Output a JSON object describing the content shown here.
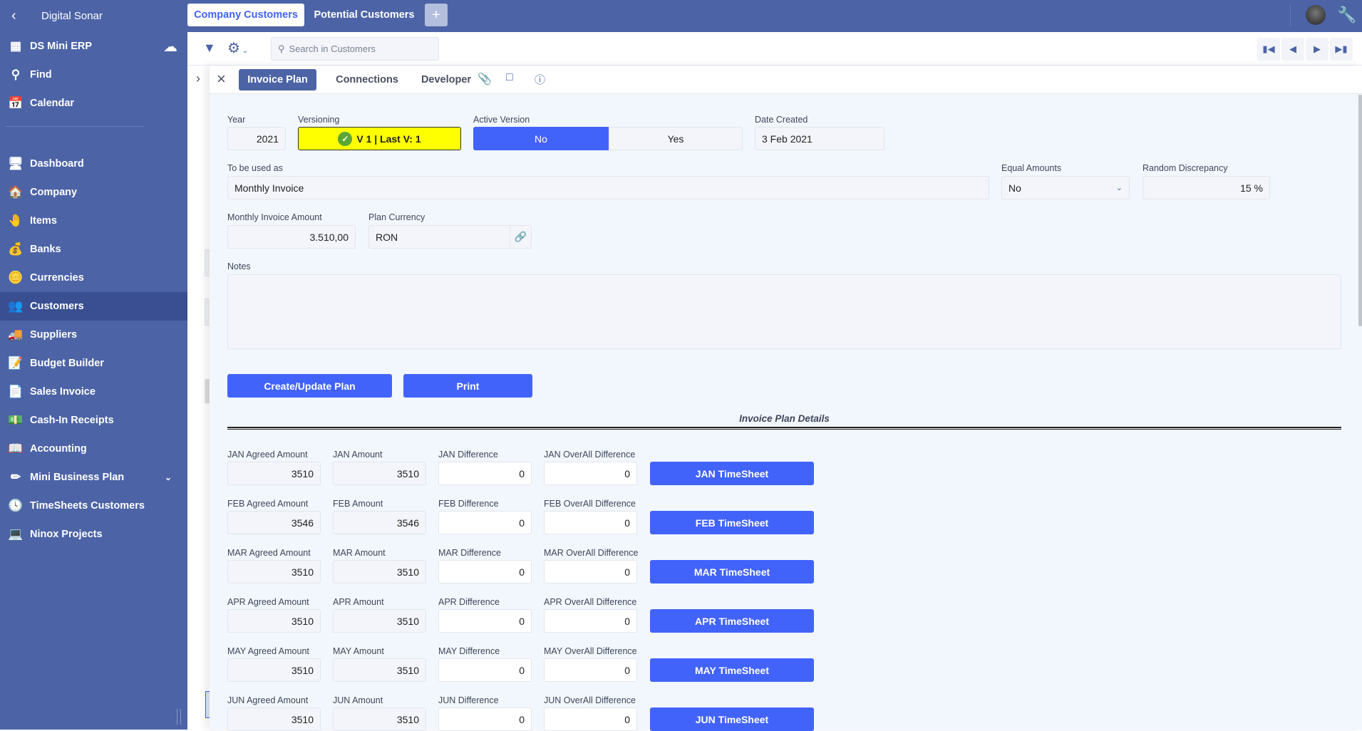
{
  "app": {
    "workspace": "Digital Sonar",
    "database": "DS Mini ERP"
  },
  "sidebar": {
    "items": [
      {
        "label": "Find",
        "icon": "search-icon"
      },
      {
        "label": "Calendar",
        "icon": "calendar-icon"
      },
      {
        "label": "Dashboard",
        "icon": "monitor-icon"
      },
      {
        "label": "Company",
        "icon": "house-icon"
      },
      {
        "label": "Items",
        "icon": "hand-coin-icon"
      },
      {
        "label": "Banks",
        "icon": "money-bag-icon"
      },
      {
        "label": "Currencies",
        "icon": "coins-icon"
      },
      {
        "label": "Customers",
        "icon": "people-icon",
        "active": true
      },
      {
        "label": "Suppliers",
        "icon": "truck-icon"
      },
      {
        "label": "Budget Builder",
        "icon": "edit-document-icon"
      },
      {
        "label": "Sales Invoice",
        "icon": "document-icon"
      },
      {
        "label": "Cash-In Receipts",
        "icon": "cash-hand-icon"
      },
      {
        "label": "Accounting",
        "icon": "book-icon"
      },
      {
        "label": "Mini Business Plan",
        "icon": "pencil-icon",
        "expandable": true
      },
      {
        "label": "TimeSheets Customers",
        "icon": "clock-icon"
      },
      {
        "label": "Ninox Projects",
        "icon": "computer-icon"
      }
    ]
  },
  "tabs": [
    {
      "label": "Company Customers",
      "active": true
    },
    {
      "label": "Potential Customers"
    }
  ],
  "toolbar": {
    "search_placeholder": "Search in Customers"
  },
  "record_tabs": [
    {
      "label": "Invoice Plan",
      "active": true
    },
    {
      "label": "Connections"
    },
    {
      "label": "Developer"
    }
  ],
  "form": {
    "year": {
      "label": "Year",
      "value": "2021"
    },
    "versioning": {
      "label": "Versioning",
      "value": "V 1 | Last V: 1",
      "color": "#ffff00"
    },
    "active_version": {
      "label": "Active Version",
      "options": [
        "No",
        "Yes"
      ],
      "selected": "No"
    },
    "date_created": {
      "label": "Date Created",
      "value": "3 Feb 2021"
    },
    "used_as": {
      "label": "To be used as",
      "value": "Monthly Invoice"
    },
    "equal_amounts": {
      "label": "Equal Amounts",
      "value": "No"
    },
    "random_discrepancy": {
      "label": "Random Discrepancy",
      "value": "15 %"
    },
    "monthly_amount": {
      "label": "Monthly Invoice Amount",
      "value": "3.510,00"
    },
    "plan_currency": {
      "label": "Plan Currency",
      "value": "RON"
    },
    "notes": {
      "label": "Notes",
      "value": ""
    },
    "create_button": "Create/Update Plan",
    "print_button": "Print"
  },
  "details": {
    "title": "Invoice Plan Details",
    "rows": [
      {
        "agreed_label": "JAN Agreed Amount",
        "agreed": "3510",
        "amount_label": "JAN Amount",
        "amount": "3510",
        "diff_label": "JAN Difference",
        "diff": "0",
        "overall_label": "JAN OverAll Difference",
        "overall": "0",
        "button": "JAN TimeSheet"
      },
      {
        "agreed_label": "FEB Agreed Amount",
        "agreed": "3546",
        "amount_label": "FEB Amount",
        "amount": "3546",
        "diff_label": "FEB Difference",
        "diff": "0",
        "overall_label": "FEB OverAll Difference",
        "overall": "0",
        "button": "FEB TimeSheet"
      },
      {
        "agreed_label": "MAR Agreed Amount",
        "agreed": "3510",
        "amount_label": "MAR Amount",
        "amount": "3510",
        "diff_label": "MAR Difference",
        "diff": "0",
        "overall_label": "MAR OverAll Difference",
        "overall": "0",
        "button": "MAR TimeSheet"
      },
      {
        "agreed_label": "APR Agreed Amount",
        "agreed": "3510",
        "amount_label": "APR Amount",
        "amount": "3510",
        "diff_label": "APR Difference",
        "diff": "0",
        "overall_label": "APR OverAll Difference",
        "overall": "0",
        "button": "APR TimeSheet"
      },
      {
        "agreed_label": "MAY Agreed Amount",
        "agreed": "3510",
        "amount_label": "MAY Amount",
        "amount": "3510",
        "diff_label": "MAY Difference",
        "diff": "0",
        "overall_label": "MAY OverAll Difference",
        "overall": "0",
        "button": "MAY TimeSheet"
      },
      {
        "agreed_label": "JUN Agreed Amount",
        "agreed": "3510",
        "amount_label": "JUN Amount",
        "amount": "3510",
        "diff_label": "JUN Difference",
        "diff": "0",
        "overall_label": "JUN OverAll Difference",
        "overall": "0",
        "button": "JUN TimeSheet"
      }
    ]
  },
  "colors": {
    "brand": "#4c63a6",
    "accent": "#4263fa"
  }
}
